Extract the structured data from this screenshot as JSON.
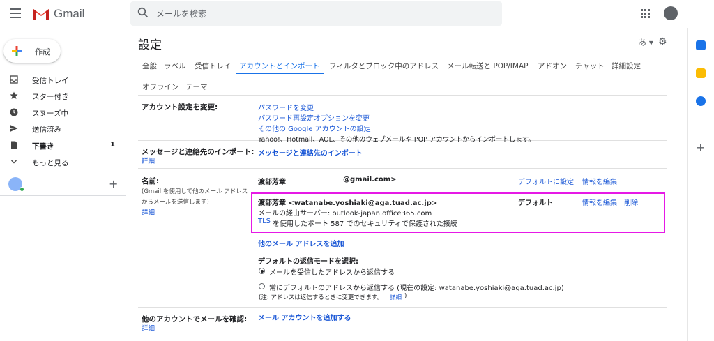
{
  "header": {
    "app_name": "Gmail",
    "search_placeholder": "メールを検索"
  },
  "nav": {
    "compose_label": "作成",
    "items": [
      {
        "label": "受信トレイ",
        "icon": "inbox-icon"
      },
      {
        "label": "スター付き",
        "icon": "star-icon"
      },
      {
        "label": "スヌーズ中",
        "icon": "clock-icon"
      },
      {
        "label": "送信済み",
        "icon": "send-icon"
      },
      {
        "label": "下書き",
        "icon": "draft-icon",
        "count": "1"
      },
      {
        "label": "もっと見る",
        "icon": "chevron-down-icon"
      }
    ],
    "add_label": "+"
  },
  "settings": {
    "title": "設定",
    "lang_button": "あ ▾",
    "tabs": [
      "全般",
      "ラベル",
      "受信トレイ",
      "アカウントとインポート",
      "フィルタとブロック中のアドレス",
      "メール転送と POP/IMAP",
      "アドオン",
      "チャット",
      "詳細設定",
      "オフライン",
      "テーマ"
    ],
    "active_tab": "アカウントとインポート",
    "sections": {
      "change_account": {
        "label": "アカウント設定を変更:",
        "links": [
          "パスワードを変更",
          "パスワード再設定オプションを変更",
          "その他の Google アカウントの設定"
        ]
      },
      "import": {
        "label": "メッセージと連絡先のインポート:",
        "detail": "詳細",
        "description": "Yahoo!、Hotmail、AOL、その他のウェブメールや POP アカウントからインポートします。",
        "link": "メッセージと連絡先のインポート"
      },
      "send_as": {
        "label": "名前:",
        "sub1": "(Gmail を使用して他のメール アドレス",
        "sub2": "からメールを送信します)",
        "detail": "詳細",
        "row1": {
          "name": "渡部芳章",
          "email": "@gmail.com>",
          "set_default": "デフォルトに設定",
          "edit": "情報を編集"
        },
        "row2": {
          "name_email": "渡部芳章 <watanabe.yoshiaki@aga.tuad.ac.jp>",
          "server": "メールの経由サーバー: outlook-japan.office365.com",
          "tls_link": "TLS",
          "tls_text": "を使用したポート 587 でのセキュリティで保護された接続",
          "default": "デフォルト",
          "edit": "情報を編集",
          "delete": "削除"
        },
        "add_address": "他のメール アドレスを追加",
        "reply_mode_label": "デフォルトの返信モードを選択:",
        "reply_option1": "メールを受信したアドレスから返信する",
        "reply_option2": "常にデフォルトのアドレスから返信する (現在の設定: watanabe.yoshiaki@aga.tuad.ac.jp)",
        "note": "(注: アドレスは返信するときに変更できます。",
        "note_link": "詳細",
        "note_end": ")"
      },
      "check_mail": {
        "label": "他のアカウントでメールを確認:",
        "detail": "詳細",
        "link": "メール アカウントを追加する"
      }
    }
  },
  "colors": {
    "accent": "#1a73e8",
    "link": "#1a57d6",
    "highlight": "#e619e6",
    "gmail_red": "#ea4335"
  }
}
